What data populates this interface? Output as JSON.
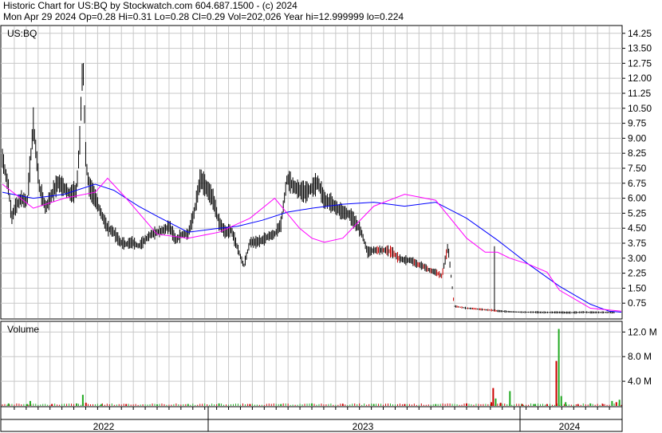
{
  "header": {
    "line1": "Historic Chart for US:BQ by Stockwatch.com 604.687.1500 - (c) 2024",
    "line2": "Mon Apr 29 2024  Op=0.28  Hi=0.31  Lo=0.28  Cl=0.29  Vol=202,026  Year hi=12.999999  lo=0.224"
  },
  "chart_data": [
    {
      "type": "line",
      "title": "US:BQ",
      "y_ticks": [
        "14.25",
        "13.50",
        "12.75",
        "12.00",
        "11.25",
        "10.50",
        "9.75",
        "9.00",
        "8.25",
        "7.50",
        "6.75",
        "6.00",
        "5.25",
        "4.50",
        "3.75",
        "3.00",
        "2.25",
        "1.50",
        "0.75"
      ],
      "y_tick_values": [
        14.25,
        13.5,
        12.75,
        12.0,
        11.25,
        10.5,
        9.75,
        9.0,
        8.25,
        7.5,
        6.75,
        6.0,
        5.25,
        4.5,
        3.75,
        3.0,
        2.25,
        1.5,
        0.75
      ],
      "ylim": [
        0,
        14.6
      ],
      "x_labels": [
        "2022",
        "2023",
        "2024"
      ],
      "x_index_range": [
        0,
        100
      ],
      "grid": true,
      "colors": {
        "price_up": "#000000",
        "price_down": "#cc0000",
        "ma_short": "#ff00ff",
        "ma_long": "#0000ff",
        "grid": "#c8c8c8"
      },
      "price_x": [
        0,
        1,
        1.5,
        2,
        3,
        4,
        5,
        6,
        7,
        8,
        9,
        10,
        11,
        12,
        12.5,
        13,
        13.5,
        14,
        15,
        16,
        17,
        18,
        19,
        20,
        21,
        22,
        23,
        24,
        25,
        26,
        27,
        28,
        29,
        30,
        31,
        32,
        33,
        34,
        35,
        36,
        37,
        38,
        39,
        40,
        41,
        42,
        43,
        44,
        45,
        46,
        47,
        48,
        49,
        50,
        51,
        52,
        53,
        54,
        55,
        56,
        57,
        58,
        59,
        60,
        61,
        62,
        63,
        64,
        65,
        66,
        67,
        68,
        69,
        70,
        71,
        72,
        73,
        74,
        75,
        76,
        77,
        78,
        79,
        79.5,
        80,
        80.5,
        81,
        82,
        83,
        84,
        85,
        86,
        87,
        88,
        89,
        90,
        91,
        92,
        93,
        94,
        95,
        96,
        97,
        98,
        99,
        100
      ],
      "price_y": [
        8.0,
        6.5,
        5.0,
        5.5,
        6.0,
        5.8,
        9.7,
        6.5,
        5.5,
        6.2,
        6.8,
        6.5,
        6.2,
        6.4,
        8.9,
        13.0,
        7.8,
        6.6,
        6.0,
        5.2,
        4.5,
        4.3,
        3.8,
        3.7,
        3.8,
        3.6,
        3.9,
        4.2,
        4.3,
        4.4,
        4.6,
        3.9,
        4.2,
        4.2,
        5.3,
        7.0,
        6.5,
        6.0,
        4.8,
        4.3,
        4.4,
        3.5,
        2.6,
        3.8,
        3.8,
        3.9,
        4.1,
        4.2,
        4.7,
        7.0,
        6.6,
        6.4,
        6.3,
        6.5,
        6.8,
        5.9,
        5.8,
        5.5,
        5.3,
        5.2,
        4.8,
        4.3,
        3.3,
        3.4,
        3.4,
        3.4,
        3.3,
        3.0,
        2.9,
        2.9,
        2.7,
        2.6,
        2.4,
        2.3,
        2.1,
        3.6,
        0.6,
        0.55,
        0.5,
        0.48,
        0.45,
        0.42,
        0.4,
        0.38,
        0.36,
        0.35,
        0.34,
        0.32,
        0.31,
        0.3,
        0.3,
        0.3,
        0.29,
        0.29,
        0.29,
        0.29,
        0.28,
        0.28,
        0.29,
        0.3,
        0.29,
        0.29,
        0.29,
        0.29,
        0.29
      ],
      "ma_short_x": [
        0,
        5,
        10,
        15,
        17,
        20,
        25,
        30,
        35,
        40,
        44,
        48,
        50,
        52,
        55,
        60,
        65,
        70,
        75,
        78,
        79,
        80,
        82,
        85,
        88,
        90,
        95,
        100
      ],
      "ma_short_y": [
        6.7,
        5.5,
        6.0,
        6.3,
        7.0,
        6.0,
        4.2,
        4.0,
        4.3,
        5.0,
        6.0,
        4.5,
        4.0,
        3.8,
        4.0,
        5.6,
        6.2,
        5.9,
        4.0,
        3.3,
        3.3,
        3.3,
        3.0,
        2.7,
        2.3,
        1.4,
        0.5,
        0.35
      ],
      "ma_long_x": [
        0,
        5,
        10,
        15,
        18,
        22,
        25,
        30,
        35,
        38,
        42,
        46,
        50,
        55,
        60,
        65,
        70,
        75,
        80,
        85,
        90,
        95,
        98,
        100
      ],
      "ma_long_y": [
        6.3,
        6.0,
        6.2,
        6.7,
        6.4,
        5.6,
        5.1,
        4.3,
        4.5,
        4.6,
        4.9,
        5.3,
        5.5,
        5.7,
        5.8,
        5.6,
        5.8,
        5.0,
        3.9,
        2.7,
        1.6,
        0.7,
        0.35,
        0.3
      ]
    },
    {
      "type": "bar",
      "title": "Volume",
      "y_ticks": [
        "12.0 M",
        "8.0 M",
        "4.0 M"
      ],
      "y_tick_values": [
        12.0,
        8.0,
        4.0
      ],
      "ylim": [
        0,
        13.6
      ],
      "unit": "M",
      "x_labels": [
        "2022",
        "2023",
        "2024"
      ],
      "grid": true,
      "bars": [
        {
          "x": 1,
          "v": 0.4,
          "c": "#22aa22"
        },
        {
          "x": 4,
          "v": 0.3,
          "c": "#22aa22"
        },
        {
          "x": 4.5,
          "v": 0.8,
          "c": "#22aa22"
        },
        {
          "x": 8,
          "v": 0.3,
          "c": "#cc0000"
        },
        {
          "x": 12,
          "v": 0.4,
          "c": "#22aa22"
        },
        {
          "x": 13,
          "v": 1.8,
          "c": "#22aa22"
        },
        {
          "x": 13.5,
          "v": 0.5,
          "c": "#cc0000"
        },
        {
          "x": 16,
          "v": 0.3,
          "c": "#22aa22"
        },
        {
          "x": 20,
          "v": 0.3,
          "c": "#cc0000"
        },
        {
          "x": 25,
          "v": 0.25,
          "c": "#22aa22"
        },
        {
          "x": 30,
          "v": 0.3,
          "c": "#22aa22"
        },
        {
          "x": 35,
          "v": 0.4,
          "c": "#22aa22"
        },
        {
          "x": 40,
          "v": 0.3,
          "c": "#cc0000"
        },
        {
          "x": 45,
          "v": 0.3,
          "c": "#22aa22"
        },
        {
          "x": 50,
          "v": 0.4,
          "c": "#22aa22"
        },
        {
          "x": 55,
          "v": 0.3,
          "c": "#cc0000"
        },
        {
          "x": 60,
          "v": 0.3,
          "c": "#22aa22"
        },
        {
          "x": 65,
          "v": 0.3,
          "c": "#cc0000"
        },
        {
          "x": 70,
          "v": 0.3,
          "c": "#22aa22"
        },
        {
          "x": 75,
          "v": 0.4,
          "c": "#cc0000"
        },
        {
          "x": 79,
          "v": 0.6,
          "c": "#cc0000"
        },
        {
          "x": 79.3,
          "v": 2.9,
          "c": "#cc0000"
        },
        {
          "x": 79.7,
          "v": 1.2,
          "c": "#22aa22"
        },
        {
          "x": 80.5,
          "v": 0.5,
          "c": "#cc0000"
        },
        {
          "x": 82,
          "v": 2.4,
          "c": "#22aa22"
        },
        {
          "x": 84,
          "v": 0.3,
          "c": "#cc0000"
        },
        {
          "x": 86,
          "v": 0.3,
          "c": "#22aa22"
        },
        {
          "x": 88,
          "v": 0.3,
          "c": "#cc0000"
        },
        {
          "x": 89.5,
          "v": 7.3,
          "c": "#cc0000"
        },
        {
          "x": 89.9,
          "v": 12.5,
          "c": "#22aa22"
        },
        {
          "x": 90.3,
          "v": 1.6,
          "c": "#22aa22"
        },
        {
          "x": 91,
          "v": 0.6,
          "c": "#22aa22"
        },
        {
          "x": 93,
          "v": 0.3,
          "c": "#cc0000"
        },
        {
          "x": 95,
          "v": 0.4,
          "c": "#22aa22"
        },
        {
          "x": 97,
          "v": 0.3,
          "c": "#cc0000"
        },
        {
          "x": 98.5,
          "v": 0.8,
          "c": "#22aa22"
        },
        {
          "x": 99.2,
          "v": 0.6,
          "c": "#cc0000"
        },
        {
          "x": 99.7,
          "v": 1.0,
          "c": "#22aa22"
        }
      ]
    }
  ]
}
